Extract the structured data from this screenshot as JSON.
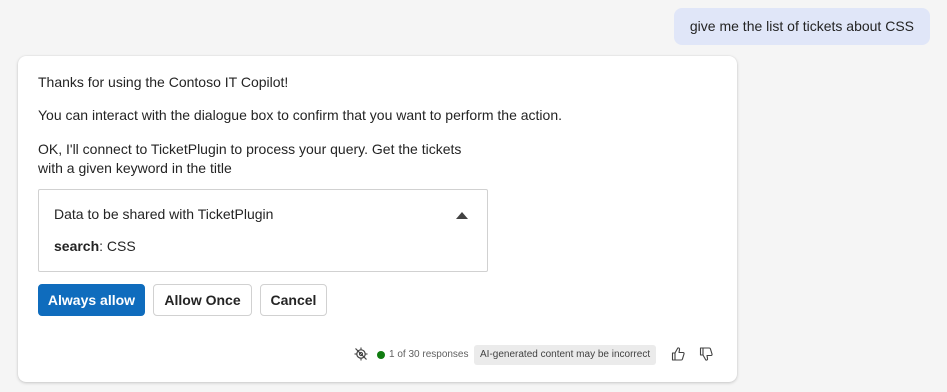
{
  "user_message": "give me the list of tickets about CSS",
  "response": {
    "line1": "Thanks for using the Contoso IT Copilot!",
    "line2": "You can interact with the dialogue box to confirm that you want to perform the action.",
    "line3": "OK, I'll connect to TicketPlugin to process your query. Get the tickets with a given keyword in the title",
    "data_box": {
      "title": "Data to be shared with TicketPlugin",
      "param_name": "search",
      "param_value": ": CSS"
    },
    "buttons": {
      "always_allow": "Always allow",
      "allow_once": "Allow Once",
      "cancel": "Cancel"
    },
    "footer": {
      "responses": "1 of 30 responses",
      "disclaimer": "AI-generated content may be incorrect"
    }
  },
  "colors": {
    "primary": "#0f6cbd",
    "user_bubble": "#e0e6f8",
    "status_dot": "#107c10"
  }
}
